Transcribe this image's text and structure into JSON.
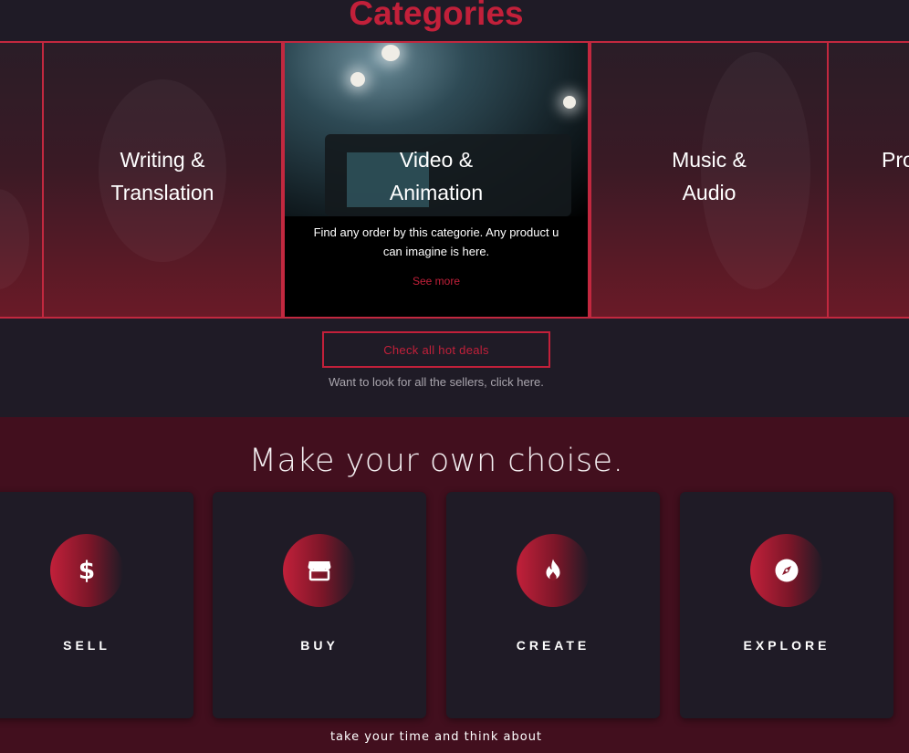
{
  "categories": {
    "title": "Categories",
    "cards": [
      {
        "label": ""
      },
      {
        "label": "Writing &\nTranslation"
      },
      {
        "label": "Video &\nAnimation",
        "description": "Find any order by this categorie. Any product u can imagine is here.",
        "link": "See more"
      },
      {
        "label": "Music &\nAudio"
      },
      {
        "label": "Pro"
      }
    ],
    "hot_deals_button": "Check all hot deals",
    "sellers_text": "Want to look for all the sellers, click here."
  },
  "choice": {
    "title": "Make your own choise.",
    "tiles": [
      {
        "label": "SELL",
        "icon": "dollar-icon"
      },
      {
        "label": "BUY",
        "icon": "store-icon"
      },
      {
        "label": "CREATE",
        "icon": "fire-icon"
      },
      {
        "label": "EXPLORE",
        "icon": "compass-icon"
      }
    ],
    "footer_text": "take your time and think about"
  },
  "colors": {
    "accent": "#c2203a",
    "background": "#1f1b26",
    "section": "#420f1e"
  }
}
